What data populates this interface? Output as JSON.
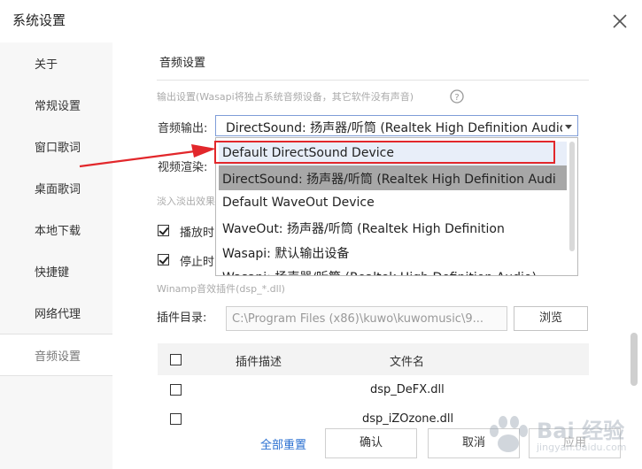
{
  "window": {
    "title": "系统设置"
  },
  "sidebar": {
    "items": [
      {
        "label": "关于"
      },
      {
        "label": "常规设置"
      },
      {
        "label": "窗口歌词"
      },
      {
        "label": "桌面歌词"
      },
      {
        "label": "本地下载"
      },
      {
        "label": "快捷键"
      },
      {
        "label": "网络代理"
      },
      {
        "label": "音频设置",
        "active": true
      }
    ]
  },
  "audio": {
    "section_title": "音频设置",
    "output_desc": "输出设置(Wasapi将独占系统音频设备，其它软件没有声音)",
    "output_label": "音频输出:",
    "output_value": "DirectSound: 扬声器/听筒 (Realtek High Definition Audio)",
    "video_label": "视频渲染:",
    "fade_label": "淡入淡出效果",
    "checkbox1_label": "播放时",
    "checkbox2_label": "停止时",
    "plugin_desc": "Winamp音效插件(dsp_*.dll)",
    "plugin_dir_label": "插件目录:",
    "plugin_dir_value": "C:\\Program Files (x86)\\kuwo\\kuwomusic\\9...",
    "browse_label": "浏览",
    "table": {
      "headers": [
        "插件描述",
        "文件名"
      ],
      "rows": [
        {
          "desc": "",
          "file": "dsp_DeFX.dll"
        },
        {
          "desc": "",
          "file": "dsp_iZOzone.dll"
        }
      ]
    },
    "dropdown_options": [
      "Default DirectSound Device",
      "DirectSound: 扬声器/听筒 (Realtek High Definition Audi",
      "Default WaveOut Device",
      "WaveOut: 扬声器/听筒 (Realtek High Definition",
      "Wasapi: 默认输出设备",
      "Wasapi: 扬声器/听筒 (Realtek High Definition Audio)"
    ],
    "selected_option_index": 1,
    "hover_option_index": 0
  },
  "footer": {
    "reset_label": "全部重置",
    "ok_label": "确认",
    "cancel_label": "取消",
    "apply_label": "应用"
  },
  "watermark": {
    "text": "Bai 经验",
    "sub": "jingyan.baidu.com"
  },
  "colors": {
    "accent_link": "#2a6fd1",
    "annotation": "#e2272b",
    "selected_option": "#a7a7a7"
  }
}
